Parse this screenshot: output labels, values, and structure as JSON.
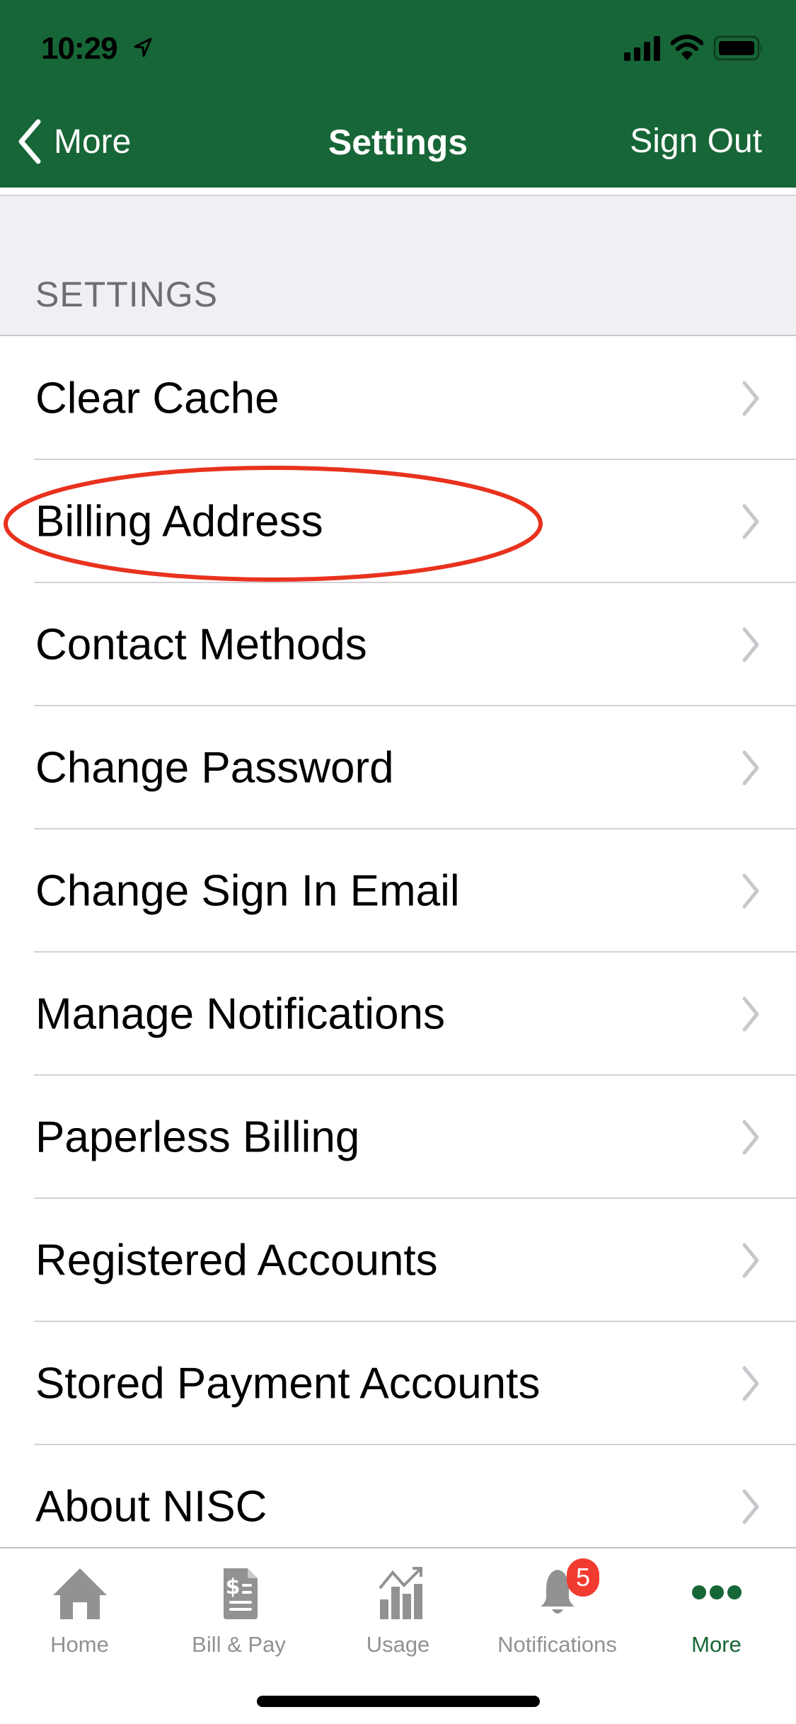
{
  "status_bar": {
    "time": "10:29",
    "icons": [
      "location-arrow-icon",
      "cellular-signal-icon",
      "wifi-icon",
      "battery-icon"
    ]
  },
  "nav_bar": {
    "back_label": "More",
    "title": "Settings",
    "right_action": "Sign Out"
  },
  "section": {
    "title": "SETTINGS"
  },
  "items": [
    {
      "label": "Clear Cache"
    },
    {
      "label": "Billing Address",
      "annotated": true
    },
    {
      "label": "Contact Methods"
    },
    {
      "label": "Change Password"
    },
    {
      "label": "Change Sign In Email"
    },
    {
      "label": "Manage Notifications"
    },
    {
      "label": "Paperless Billing"
    },
    {
      "label": "Registered Accounts"
    },
    {
      "label": "Stored Payment Accounts"
    },
    {
      "label": "About NISC"
    }
  ],
  "tab_bar": {
    "tabs": [
      {
        "label": "Home",
        "icon": "home-icon",
        "active": false
      },
      {
        "label": "Bill & Pay",
        "icon": "bill-document-icon",
        "active": false
      },
      {
        "label": "Usage",
        "icon": "usage-chart-icon",
        "active": false
      },
      {
        "label": "Notifications",
        "icon": "bell-icon",
        "active": false,
        "badge": "5"
      },
      {
        "label": "More",
        "icon": "more-dots-icon",
        "active": true
      }
    ]
  },
  "colors": {
    "brand_green": "#176637",
    "badge_red": "#f23b30",
    "annotation_red": "#e8321e",
    "inactive_gray": "#929292"
  }
}
